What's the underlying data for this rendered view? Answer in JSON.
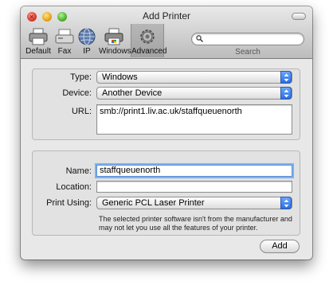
{
  "window": {
    "title": "Add Printer"
  },
  "toolbar": {
    "items": [
      {
        "label": "Default",
        "icon": "printer-icon"
      },
      {
        "label": "Fax",
        "icon": "fax-icon"
      },
      {
        "label": "IP",
        "icon": "globe-icon"
      },
      {
        "label": "Windows",
        "icon": "windows-printer-icon"
      },
      {
        "label": "Advanced",
        "icon": "gear-icon",
        "selected": true
      }
    ],
    "search": {
      "value": "",
      "caption": "Search"
    }
  },
  "connection": {
    "type_label": "Type:",
    "type_value": "Windows",
    "device_label": "Device:",
    "device_value": "Another Device",
    "url_label": "URL:",
    "url_value": "smb://print1.liv.ac.uk/staffqueuenorth"
  },
  "printer": {
    "name_label": "Name:",
    "name_value": "staffqueuenorth",
    "location_label": "Location:",
    "location_value": "",
    "print_using_label": "Print Using:",
    "print_using_value": "Generic PCL Laser Printer",
    "note": "The selected printer software isn't from the manufacturer and may not let you use all the features of your printer."
  },
  "actions": {
    "add_label": "Add"
  },
  "colors": {
    "accent": "#2a6ee6",
    "focus_ring": "#7eb2f0"
  }
}
